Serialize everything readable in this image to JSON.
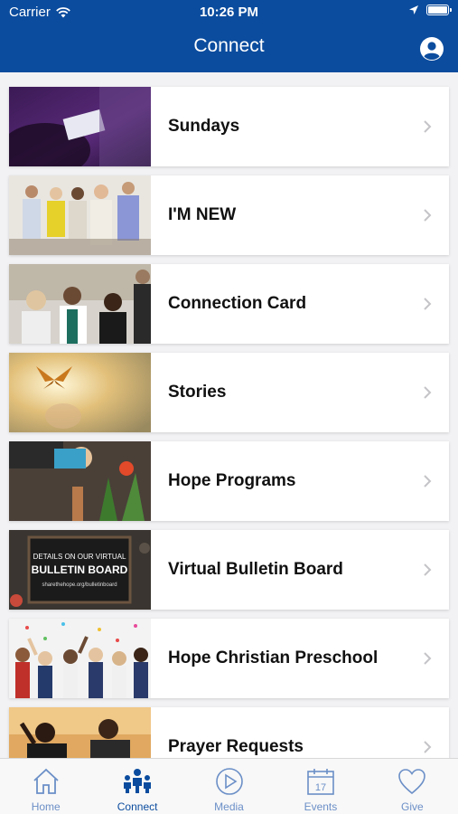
{
  "status": {
    "carrier": "Carrier",
    "time": "10:26 PM"
  },
  "header": {
    "title": "Connect"
  },
  "items": [
    {
      "label": "Sundays"
    },
    {
      "label": "I'M NEW"
    },
    {
      "label": "Connection Card"
    },
    {
      "label": "Stories"
    },
    {
      "label": "Hope Programs"
    },
    {
      "label": "Virtual Bulletin Board",
      "thumb_text": [
        "DETAILS ON OUR VIRTUAL",
        "BULLETIN BOARD",
        "sharethehope.org/bulletinboard"
      ]
    },
    {
      "label": "Hope Christian Preschool"
    },
    {
      "label": "Prayer Requests"
    }
  ],
  "tabs": [
    {
      "label": "Home",
      "icon": "home-icon"
    },
    {
      "label": "Connect",
      "icon": "people-icon",
      "active": true
    },
    {
      "label": "Media",
      "icon": "play-icon"
    },
    {
      "label": "Events",
      "icon": "calendar-icon",
      "day": "17"
    },
    {
      "label": "Give",
      "icon": "heart-icon"
    }
  ],
  "colors": {
    "header": "#0b4c9e",
    "tab_active": "#0b4c9e",
    "tab_inactive": "#6b8fc7"
  }
}
